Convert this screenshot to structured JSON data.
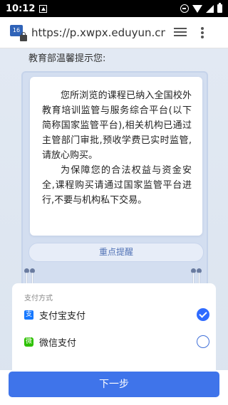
{
  "status_bar": {
    "time": "10:12"
  },
  "browser": {
    "url": "https://p.xwpx.eduyun.cn/",
    "site_icon_text": "16"
  },
  "main": {
    "greeting": "教育部温馨提示您:",
    "notice": {
      "paragraph1": "您所浏览的课程已纳入全国校外教育培训监管与服务综合平台(以下简称国家监管平台),相关机构已通过主管部门审批,预收学费已实时监管,请放心购买。",
      "paragraph2": "为保障您的合法权益与资金安全,课程购买请通过国家监管平台进行,不要与机构私下交易。"
    },
    "highlight_button": "重点提醒"
  },
  "payment": {
    "title": "支付方式",
    "options": [
      {
        "label": "支付宝支付",
        "icon": "alipay-icon",
        "icon_text": "支",
        "selected": true
      },
      {
        "label": "微信支付",
        "icon": "wechat-icon",
        "icon_text": "微",
        "selected": false
      }
    ]
  },
  "next_button": "下一步",
  "colors": {
    "accent": "#3f74ea",
    "radio_checked": "#2f6bff",
    "alipay": "#1678ff",
    "wechat": "#2dc100"
  }
}
